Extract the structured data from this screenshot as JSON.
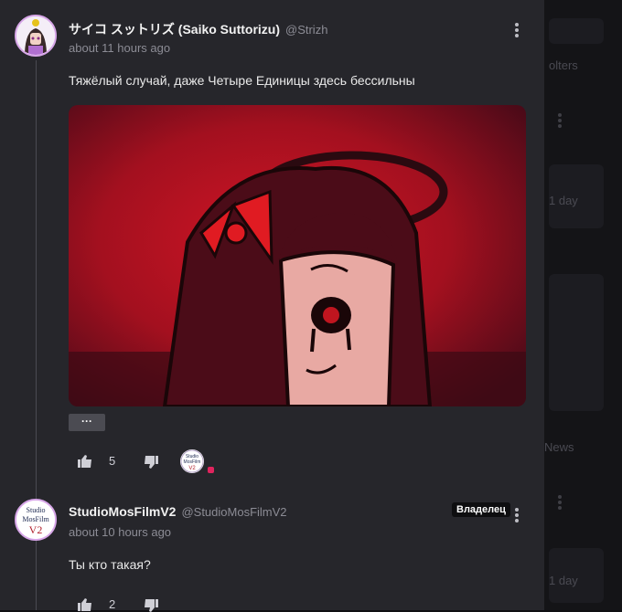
{
  "background": {
    "snippets": [
      "olters",
      "1 day",
      "News",
      "1 day"
    ]
  },
  "comments": [
    {
      "author": "サイコ スットリズ (Saiko Suttorizu)",
      "handle": "@Strizh",
      "time": "about 11 hours ago",
      "text": "Тяжёлый случай, даже Четыре Единицы здесь бессильны",
      "more_label": "···",
      "likes": "5",
      "reaction_avatar_text": "Studio MosFilm V2"
    },
    {
      "author": "StudioMosFilmV2",
      "handle": "@StudioMosFilmV2",
      "badge": "Владелец",
      "time": "about 10 hours ago",
      "text": "Ты кто такая?",
      "likes": "2",
      "avatar_text": "Studio MosFilm V2"
    }
  ],
  "colors": {
    "panel": "#26262b",
    "image_bg": "#8a1020",
    "like_red": "#e0245e"
  },
  "icons": [
    "thumbs-up-icon",
    "thumbs-down-icon",
    "more-vertical-icon"
  ]
}
